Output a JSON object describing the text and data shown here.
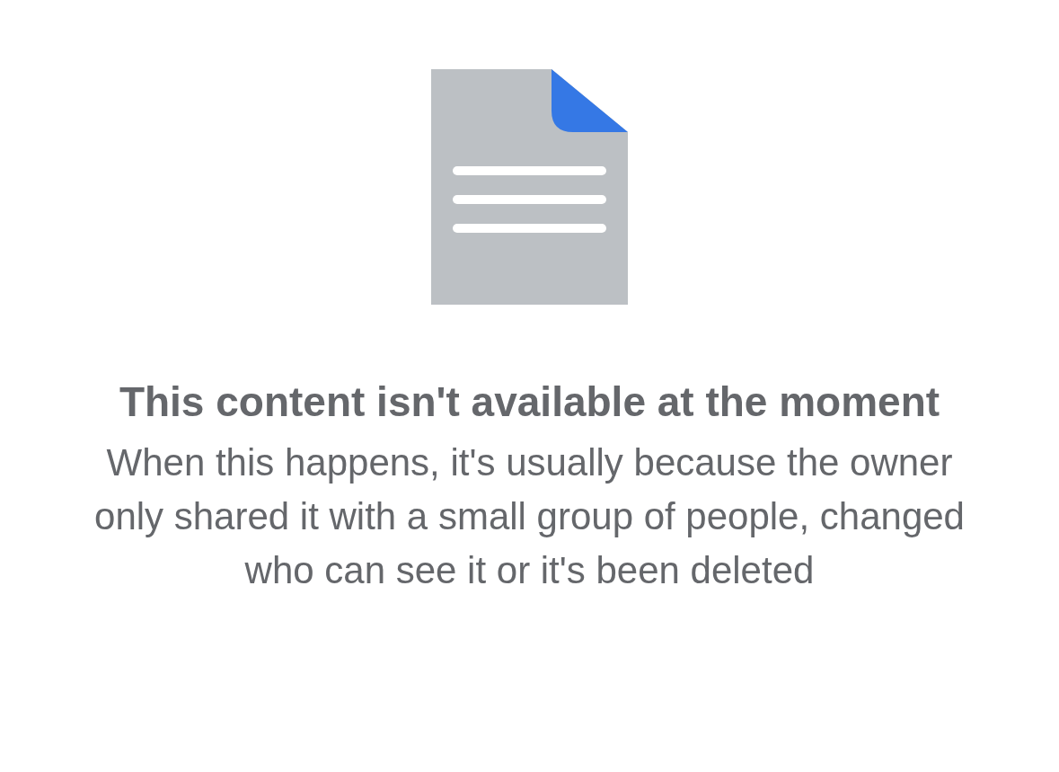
{
  "message": {
    "title": "This content isn't available at the moment",
    "body": "When this happens, it's usually because the owner only shared it with a small group of people, changed who can see it or it's been deleted"
  }
}
